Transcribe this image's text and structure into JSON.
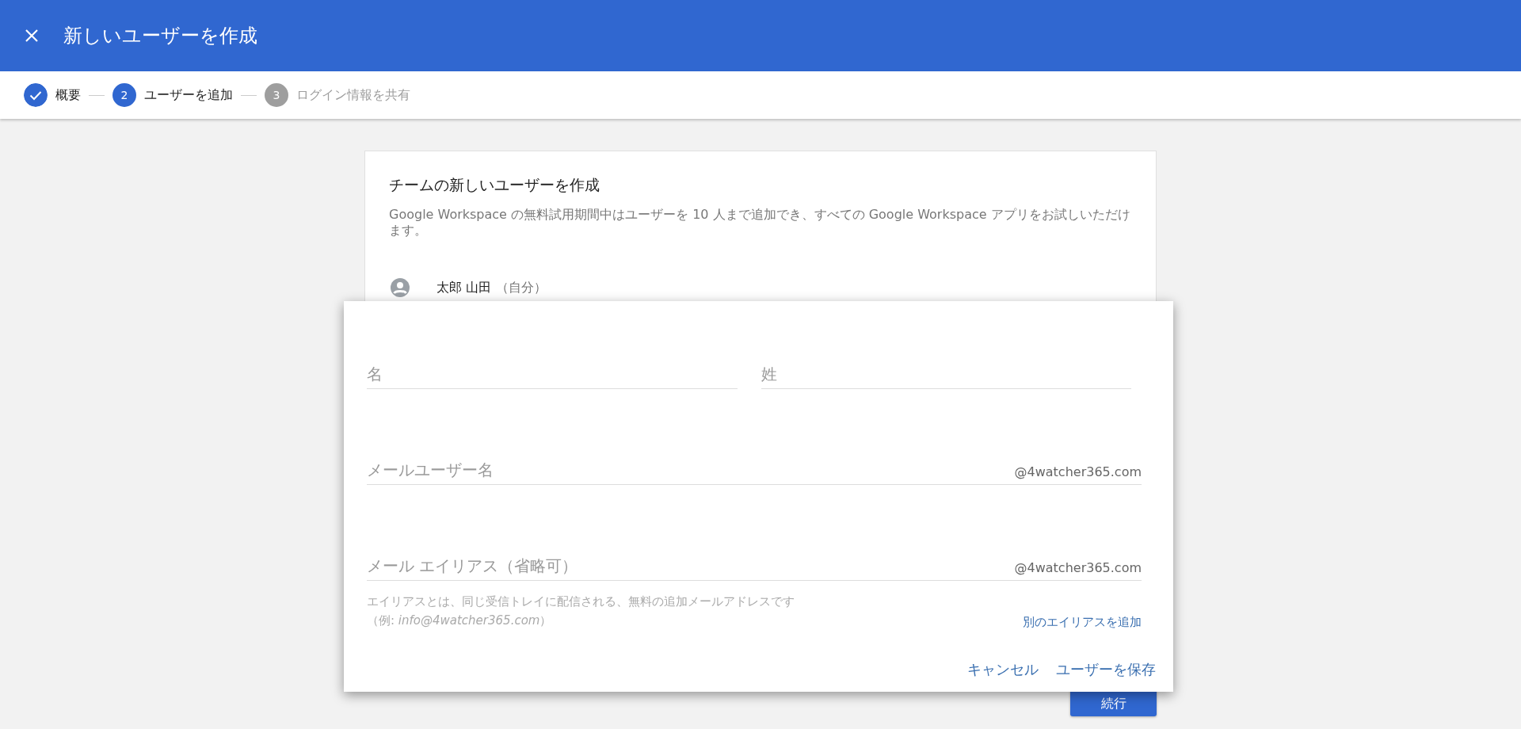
{
  "header": {
    "title": "新しいユーザーを作成"
  },
  "stepper": [
    {
      "label": "概要",
      "kind": "done"
    },
    {
      "label": "ユーザーを追加",
      "kind": "current",
      "number": "2"
    },
    {
      "label": "ログイン情報を共有",
      "kind": "upcoming",
      "number": "3"
    }
  ],
  "card": {
    "title": "チームの新しいユーザーを作成",
    "description": "Google Workspace の無料試用期間中はユーザーを 10 人まで追加でき、すべての Google Workspace アプリをお試しいただけます。",
    "users": [
      {
        "name": "太郎 山田",
        "note": "（自分）"
      }
    ],
    "continue_button": "続行"
  },
  "dialog": {
    "name_fields": [
      {
        "placeholder": "名"
      },
      {
        "placeholder": "姓"
      }
    ],
    "username_field": {
      "placeholder": "メールユーザー名",
      "suffix": "@4watcher365.com"
    },
    "alias_field": {
      "placeholder": "メール エイリアス（省略可）",
      "suffix": "@4watcher365.com"
    },
    "alias_help": [
      "エイリアスとは、同じ受信トレイに配信される、無料の追加メールアドレスです",
      "（例: *info@4watcher365.com*）"
    ],
    "add_alias_link": "別のエイリアスを追加",
    "buttons": [
      "キャンセル",
      "ユーザーを保存"
    ]
  }
}
